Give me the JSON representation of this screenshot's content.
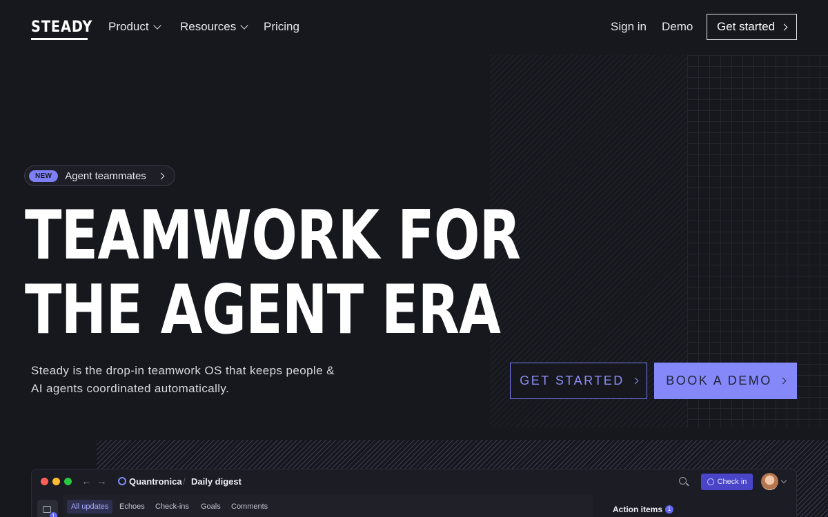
{
  "nav": {
    "logo": "STEADY",
    "links": [
      {
        "label": "Product",
        "has_dropdown": true
      },
      {
        "label": "Resources",
        "has_dropdown": true
      },
      {
        "label": "Pricing",
        "has_dropdown": false
      }
    ],
    "sign_in": "Sign in",
    "demo": "Demo",
    "get_started": "Get started"
  },
  "hero": {
    "badge": "NEW",
    "badge_text": "Agent teammates",
    "headline_line1": "TEAMWORK FOR",
    "headline_line2": "THE AGENT ERA",
    "subheading": "Steady is the drop-in teamwork OS that keeps people & AI agents coordinated automatically.",
    "cta_primary": "GET STARTED",
    "cta_secondary": "BOOK A DEMO"
  },
  "app_preview": {
    "workspace": "Quantronica",
    "separator": "/",
    "page": "Daily digest",
    "check_in": "Check in",
    "sidebar_badge": "1",
    "tabs": [
      "All updates",
      "Echoes",
      "Check-ins",
      "Goals",
      "Comments"
    ],
    "active_tab": "All updates",
    "action_items_label": "Action items",
    "action_items_count": "1"
  },
  "colors": {
    "background": "#17181e",
    "accent": "#8588f8",
    "text": "#ffffff",
    "window_red": "#ff5f57",
    "window_yellow": "#febc2e",
    "window_green": "#28c840"
  },
  "icons": [
    "chevron-down-icon",
    "chevron-right-icon",
    "back-arrow-icon",
    "forward-arrow-icon",
    "workspace-icon",
    "search-icon",
    "check-icon",
    "avatar",
    "updates-icon"
  ]
}
